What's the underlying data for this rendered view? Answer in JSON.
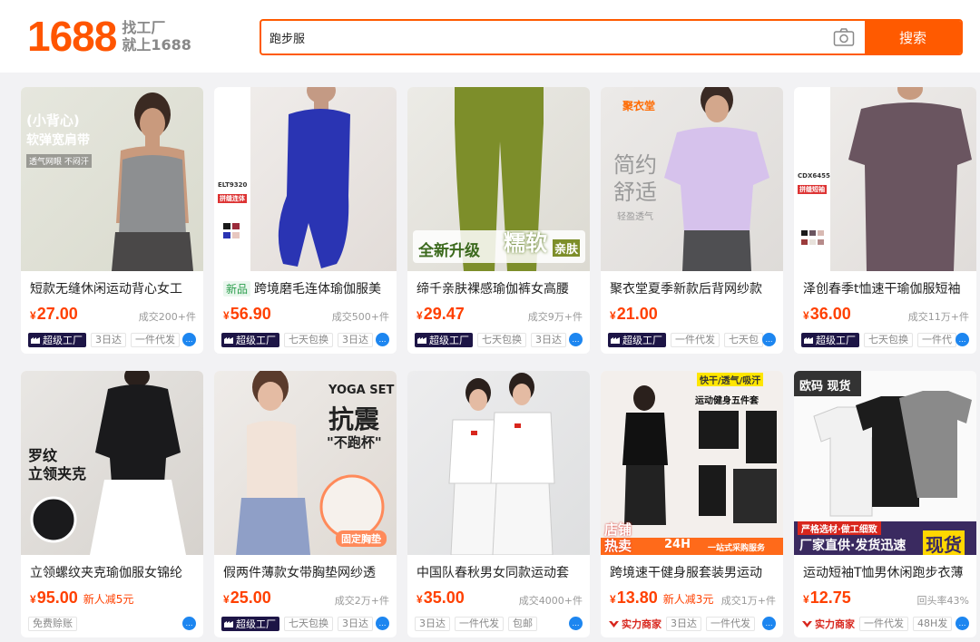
{
  "header": {
    "logo_number": "1688",
    "slogan_line1": "找工厂",
    "slogan_line2": "就上1688",
    "search_value": "跑步服",
    "search_button": "搜索"
  },
  "colors": {
    "brand": "#ff5500",
    "price": "#ff4000",
    "factory_badge": "#1d1546"
  },
  "products": [
    {
      "title": "短款无缝休闲运动背心女工",
      "currency": "¥",
      "price": "27.00",
      "sold": "成交200+件",
      "badge": "超级工厂",
      "tags": [
        "3日达",
        "一件代发"
      ],
      "overlay": [
        "(小背心)",
        "软弹宽肩带",
        "透气网眼 不闷汗"
      ]
    },
    {
      "new_label": "新品",
      "title": "跨境磨毛连体瑜伽服美",
      "currency": "¥",
      "price": "56.90",
      "sold": "成交500+件",
      "badge": "超级工厂",
      "tags": [
        "七天包换",
        "3日达"
      ],
      "overlay": [
        "ELT9320",
        "拼缝连体"
      ]
    },
    {
      "title": "缔千亲肤裸感瑜伽裤女高腰",
      "currency": "¥",
      "price": "29.47",
      "sold": "成交9万+件",
      "badge": "超级工厂",
      "tags": [
        "七天包换",
        "3日达"
      ],
      "overlay": [
        "全新升级",
        "糯软",
        "亲肤"
      ]
    },
    {
      "title": "聚衣堂夏季新款后背网纱款",
      "currency": "¥",
      "price": "21.00",
      "sold": "",
      "badge": "超级工厂",
      "tags": [
        "一件代发",
        "七天包"
      ],
      "overlay": [
        "聚衣堂",
        "简约",
        "舒适",
        "轻盈透气"
      ]
    },
    {
      "title": "泽创春季t恤速干瑜伽服短袖",
      "currency": "¥",
      "price": "36.00",
      "sold": "成交11万+件",
      "badge": "超级工厂",
      "tags": [
        "七天包换",
        "一件代"
      ],
      "overlay": [
        "CDX6455",
        "拼缝短袖"
      ]
    },
    {
      "title": "立领螺纹夹克瑜伽服女锦纶",
      "currency": "¥",
      "price": "95.00",
      "promo": "新人减5元",
      "sold": "",
      "badge": "",
      "tags": [
        "免费赊账"
      ],
      "overlay": [
        "罗纹",
        "立领夹克"
      ]
    },
    {
      "title": "假两件薄款女带胸垫网纱透",
      "currency": "¥",
      "price": "25.00",
      "sold": "成交2万+件",
      "badge": "超级工厂",
      "tags": [
        "七天包换",
        "3日达"
      ],
      "overlay": [
        "YOGA SET",
        "抗震",
        "\"不跑杯\"",
        "固定胸垫"
      ]
    },
    {
      "title": "中国队春秋男女同款运动套",
      "currency": "¥",
      "price": "35.00",
      "sold": "成交4000+件",
      "badge": "",
      "tags": [
        "3日达",
        "一件代发",
        "包邮"
      ],
      "overlay": []
    },
    {
      "title": "跨境速干健身服套装男运动",
      "currency": "¥",
      "price": "13.80",
      "promo": "新人减3元",
      "sold": "成交1万+件",
      "badge_strength": "实力商家",
      "tags": [
        "3日达",
        "一件代发"
      ],
      "overlay": [
        "快干/透气/吸汗",
        "运动健身五件套",
        "店铺",
        "热卖",
        "24H",
        "一站式采购服务"
      ]
    },
    {
      "title": "运动短袖T恤男休闲跑步衣薄",
      "currency": "¥",
      "price": "12.75",
      "sold": "回头率43%",
      "badge_strength": "实力商家",
      "tags": [
        "一件代发",
        "48H发"
      ],
      "overlay": [
        "欧码 现货",
        "严格选材·做工细致",
        "厂家直供·发货迅速",
        "现货"
      ]
    }
  ]
}
